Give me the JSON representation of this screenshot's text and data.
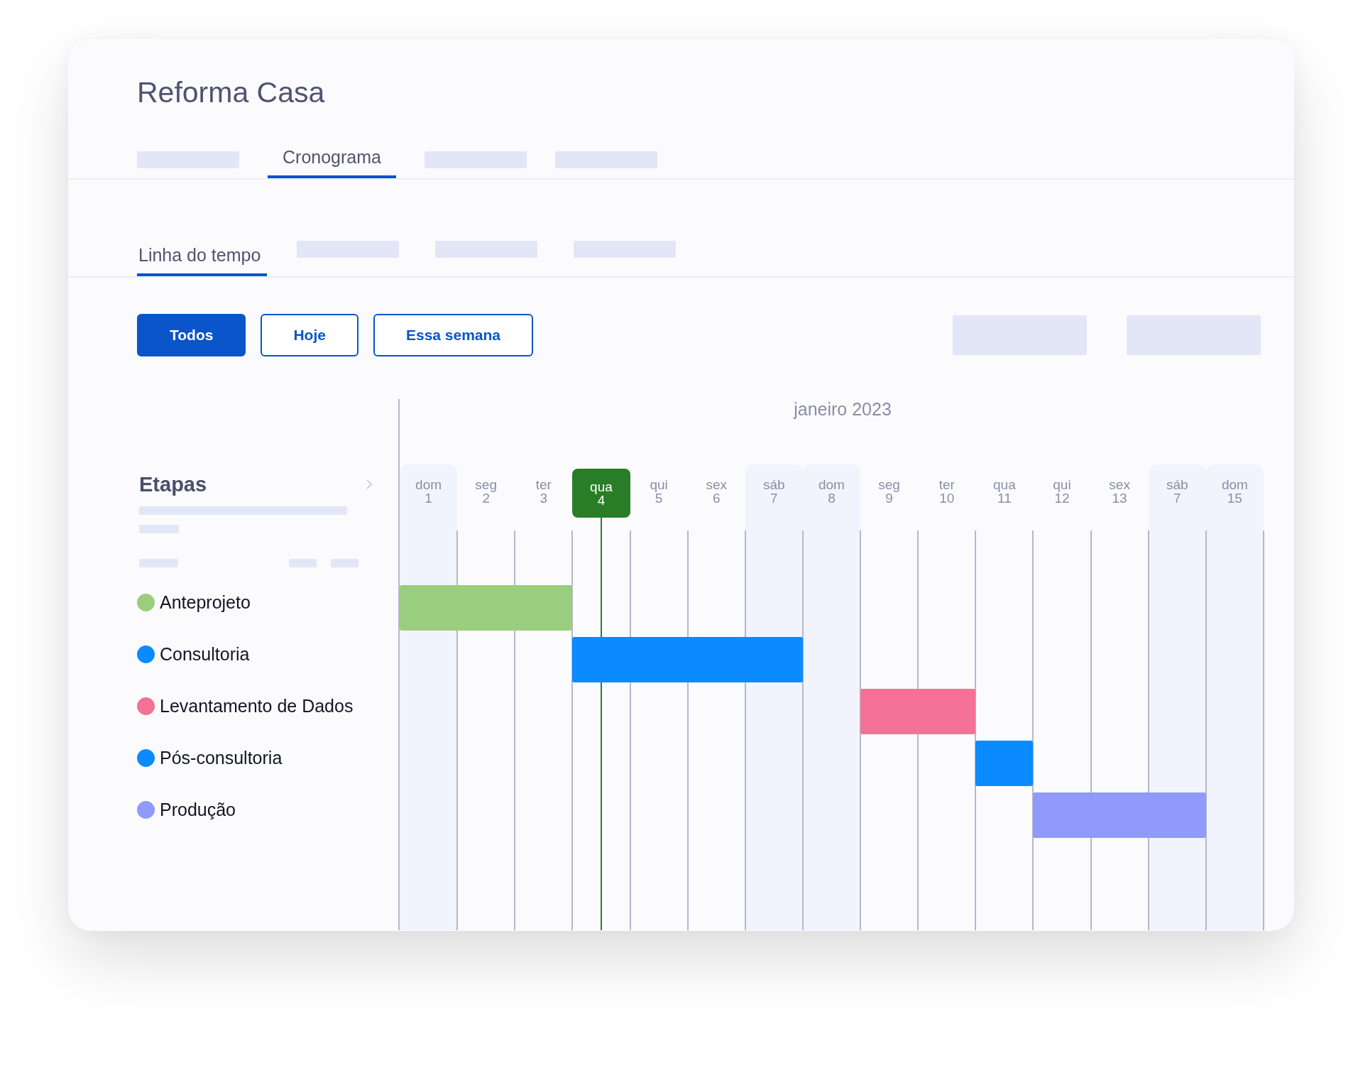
{
  "project": {
    "title": "Reforma Casa"
  },
  "tabs": [
    {
      "kind": "placeholder",
      "selected": false
    },
    {
      "kind": "label",
      "label": "Cronograma",
      "selected": true
    },
    {
      "kind": "placeholder",
      "selected": false
    },
    {
      "kind": "placeholder",
      "selected": false
    }
  ],
  "subtabs": [
    {
      "kind": "label",
      "label": "Linha do tempo",
      "selected": true
    },
    {
      "kind": "placeholder",
      "selected": false
    },
    {
      "kind": "placeholder",
      "selected": false
    },
    {
      "kind": "placeholder",
      "selected": false
    }
  ],
  "filters": [
    {
      "label": "Todos",
      "selected": true
    },
    {
      "label": "Hoje",
      "selected": false
    },
    {
      "label": "Essa semana",
      "selected": false
    }
  ],
  "stages": {
    "title": "Etapas",
    "items": [
      {
        "name": "Anteprojeto",
        "color": "#9acd7d",
        "active_days": [
          true,
          true,
          true,
          false,
          false,
          false,
          false,
          false,
          false,
          false,
          false,
          false,
          false,
          false,
          false
        ]
      },
      {
        "name": "Consultoria",
        "color": "#0a8bff",
        "active_days": [
          false,
          false,
          false,
          true,
          true,
          true,
          true,
          false,
          false,
          false,
          false,
          false,
          false,
          false,
          false
        ]
      },
      {
        "name": "Levantamento de Dados",
        "color": "#f47295",
        "active_days": [
          false,
          false,
          false,
          false,
          false,
          false,
          false,
          false,
          true,
          true,
          false,
          false,
          false,
          false,
          false
        ]
      },
      {
        "name": "Pós-consultoria",
        "color": "#0a8bff",
        "active_days": [
          false,
          false,
          false,
          false,
          false,
          false,
          false,
          false,
          false,
          false,
          true,
          false,
          false,
          false,
          false
        ]
      },
      {
        "name": "Produção",
        "color": "#8f9afc",
        "active_days": [
          false,
          false,
          false,
          false,
          false,
          false,
          false,
          false,
          false,
          false,
          false,
          true,
          true,
          true,
          false
        ]
      }
    ]
  },
  "timeline": {
    "month": "janeiro 2023",
    "days": [
      {
        "weekday": "dom",
        "date": "1",
        "weekend": true,
        "today": false
      },
      {
        "weekday": "seg",
        "date": "2",
        "weekend": false,
        "today": false
      },
      {
        "weekday": "ter",
        "date": "3",
        "weekend": false,
        "today": false
      },
      {
        "weekday": "qua",
        "date": "4",
        "weekend": false,
        "today": true
      },
      {
        "weekday": "qui",
        "date": "5",
        "weekend": false,
        "today": false
      },
      {
        "weekday": "sex",
        "date": "6",
        "weekend": false,
        "today": false
      },
      {
        "weekday": "sáb",
        "date": "7",
        "weekend": true,
        "today": false
      },
      {
        "weekday": "dom",
        "date": "8",
        "weekend": true,
        "today": false
      },
      {
        "weekday": "seg",
        "date": "9",
        "weekend": false,
        "today": false
      },
      {
        "weekday": "ter",
        "date": "10",
        "weekend": false,
        "today": false
      },
      {
        "weekday": "qua",
        "date": "11",
        "weekend": false,
        "today": false
      },
      {
        "weekday": "qui",
        "date": "12",
        "weekend": false,
        "today": false
      },
      {
        "weekday": "sex",
        "date": "13",
        "weekend": false,
        "today": false
      },
      {
        "weekday": "sáb",
        "date": "7",
        "weekend": true,
        "today": false
      },
      {
        "weekday": "dom",
        "date": "15",
        "weekend": true,
        "today": false
      }
    ]
  }
}
